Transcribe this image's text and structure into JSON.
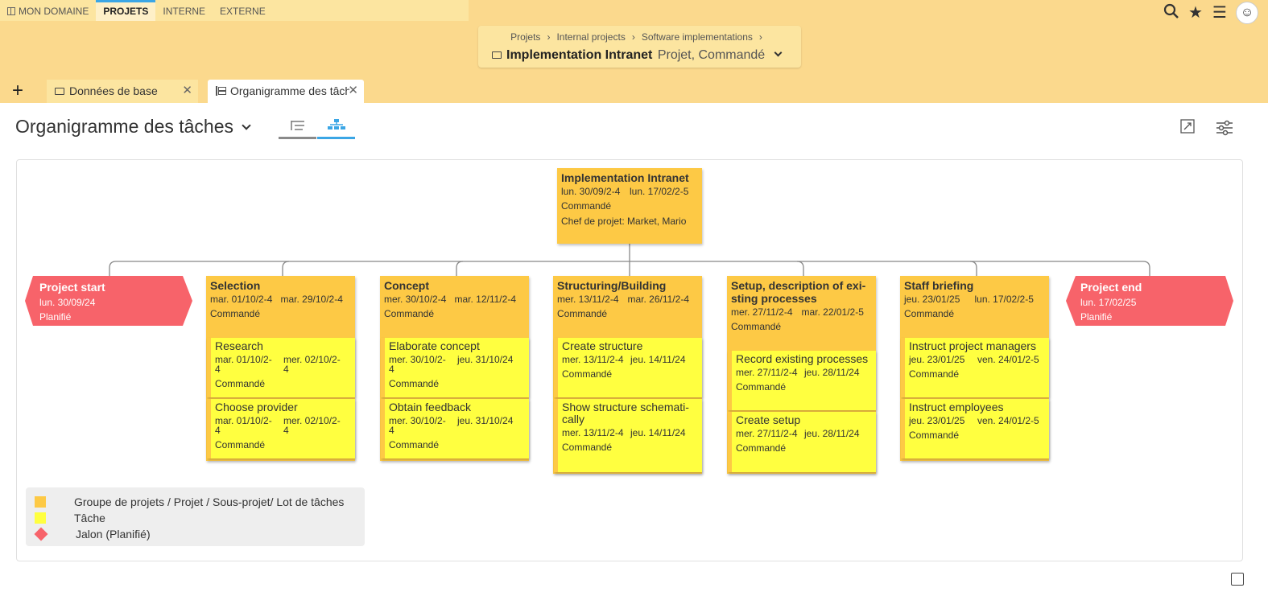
{
  "nav": {
    "items": [
      {
        "label": "MON DOMAINE",
        "active": false,
        "icon": "board-icon"
      },
      {
        "label": "PROJETS",
        "active": true
      },
      {
        "label": "INTERNE",
        "active": false
      },
      {
        "label": "EXTERNE",
        "active": false
      }
    ]
  },
  "top_icons": [
    "search-icon",
    "star-icon",
    "menu-icon",
    "avatar"
  ],
  "breadcrumb": {
    "items": [
      "Projets",
      "Internal projects",
      "Software implementations"
    ],
    "project_name": "Implementation Intranet",
    "project_status": "Projet, Commandé"
  },
  "tabs": [
    {
      "label": "Données de base",
      "icon": "folder-icon",
      "active": false
    },
    {
      "label": "Organigramme des tâches",
      "icon": "tree-icon",
      "active": true
    }
  ],
  "page_title": "Organigramme des tâches",
  "colors": {
    "header_bg": "#fbd98d",
    "accent": "#3ba6e5",
    "group": "#fdc945",
    "task": "#ffff40",
    "milestone": "#f7636a"
  },
  "root": {
    "title": "Implementation Intranet",
    "start": "lun. 30/09/2-4",
    "end": "lun. 17/02/2-5",
    "status": "Commandé",
    "manager": "Chef de projet: Market, Mario"
  },
  "milestones": {
    "start": {
      "title": "Project start",
      "date": "lun. 30/09/24",
      "status": "Planifié"
    },
    "end": {
      "title": "Project end",
      "date": "lun. 17/02/25",
      "status": "Planifié"
    }
  },
  "groups": [
    {
      "title": "Selection",
      "start": "mar. 01/10/2-4",
      "end": "mar. 29/10/2-4",
      "status": "Commandé",
      "tasks": [
        {
          "title": "Research",
          "start": "mar. 01/10/2-4",
          "end": "mer. 02/10/2-4",
          "status": "Commandé"
        },
        {
          "title": "Choose provider",
          "start": "mar. 01/10/2-4",
          "end": "mer. 02/10/2-4",
          "status": "Commandé"
        }
      ]
    },
    {
      "title": "Concept",
      "start": "mer. 30/10/2-4",
      "end": "mar. 12/11/2-4",
      "status": "Commandé",
      "tasks": [
        {
          "title": "Elaborate concept",
          "start": "mer. 30/10/2-4",
          "end": "jeu. 31/10/24",
          "status": "Commandé"
        },
        {
          "title": "Obtain feedback",
          "start": "mer. 30/10/2-4",
          "end": "jeu. 31/10/24",
          "status": "Commandé"
        }
      ]
    },
    {
      "title": "Structuring/Building",
      "start": "mer. 13/11/2-4",
      "end": "mar. 26/11/2-4",
      "status": "Commandé",
      "tasks": [
        {
          "title": "Create structure",
          "start": "mer. 13/11/2-4",
          "end": "jeu. 14/11/24",
          "status": "Commandé"
        },
        {
          "title": "Show structure schemati-cally",
          "start": "mer. 13/11/2-4",
          "end": "jeu. 14/11/24",
          "status": "Commandé"
        }
      ]
    },
    {
      "title": "Setup, description of exi-sting processes",
      "start": "mer. 27/11/2-4",
      "end": "mar. 22/01/2-5",
      "status": "Commandé",
      "tasks": [
        {
          "title": "Record existing processes",
          "start": "mer. 27/11/2-4",
          "end": "jeu. 28/11/24",
          "status": "Commandé"
        },
        {
          "title": "Create setup",
          "start": "mer. 27/11/2-4",
          "end": "jeu. 28/11/24",
          "status": "Commandé"
        }
      ]
    },
    {
      "title": "Staff briefing",
      "start": "jeu. 23/01/25",
      "end": "lun. 17/02/2-5",
      "status": "Commandé",
      "tasks": [
        {
          "title": "Instruct project managers",
          "start": "jeu. 23/01/25",
          "end": "ven. 24/01/2-5",
          "status": "Commandé"
        },
        {
          "title": "Instruct employees",
          "start": "jeu. 23/01/25",
          "end": "ven. 24/01/2-5",
          "status": "Commandé"
        }
      ]
    }
  ],
  "legend": [
    {
      "label": "Groupe de projets / Projet / Sous-projet/ Lot de tâches",
      "color": "#fdc945"
    },
    {
      "label": "Tâche",
      "color": "#ffff40"
    },
    {
      "label": "Jalon (Planifié)",
      "color": "#f7636a"
    }
  ]
}
